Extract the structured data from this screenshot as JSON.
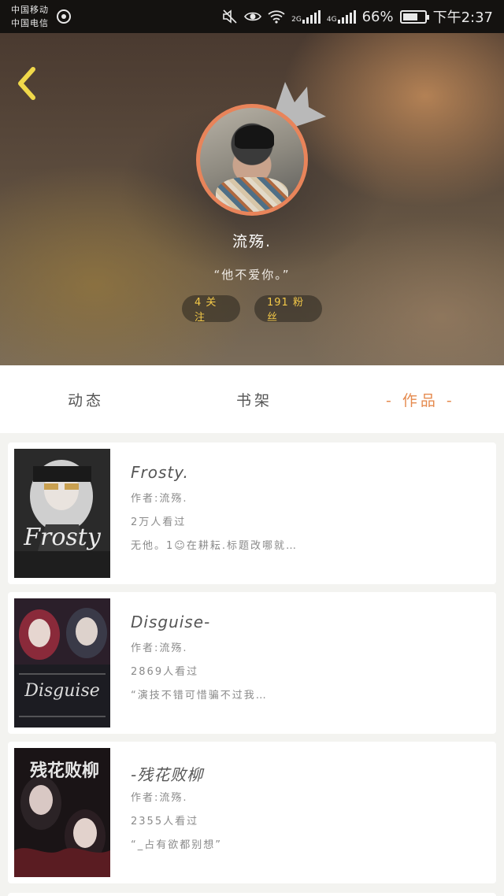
{
  "status_bar": {
    "carrier_1": "中国移动",
    "carrier_2": "中国电信",
    "signal_1": "2G",
    "signal_2": "4G",
    "battery": "66%",
    "time": "下午2:37"
  },
  "profile": {
    "username": "流殇.",
    "bio": "“他不爱你。”",
    "following": "4 关注",
    "fans": "191 粉丝"
  },
  "tabs": {
    "activity": "动态",
    "bookshelf": "书架",
    "works": "- 作品 -",
    "active": "works"
  },
  "works": [
    {
      "title": "Frosty.",
      "author": "作者:流殇.",
      "views": "2万人看过",
      "summary": "无他。1☺在耕耘.标题改哪就…",
      "cover_text": "Frosty"
    },
    {
      "title": "Disguise-",
      "author": "作者:流殇.",
      "views": "2869人看过",
      "summary": "“演技不错可惜骗不过我…",
      "cover_text": "Disguise"
    },
    {
      "title": "-残花败柳",
      "author": "作者:流殇.",
      "views": "2355人看过",
      "summary": "“_占有欲都别想”",
      "cover_text": "残花败柳"
    }
  ],
  "colors": {
    "accent_orange": "#e58a4e",
    "pill_text": "#f4c948",
    "back_icon": "#f0d84a"
  }
}
